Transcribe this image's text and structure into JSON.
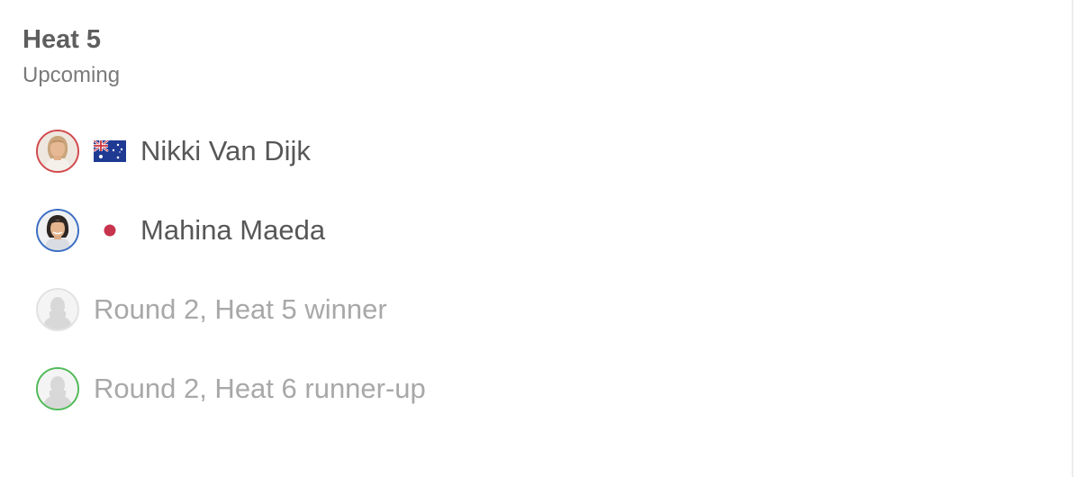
{
  "heat": {
    "title": "Heat 5",
    "status": "Upcoming"
  },
  "athletes": [
    {
      "name": "Nikki Van Dijk",
      "country_flag": "australia-flag-icon",
      "ring_color": "#d24a4f"
    },
    {
      "name": "Mahina Maeda",
      "country_flag": "japan-flag-icon",
      "ring_color": "#3d6fc4"
    }
  ],
  "placeholders": [
    {
      "label": "Round 2, Heat 5 winner",
      "ring_color": "#e2e2e2"
    },
    {
      "label": "Round 2, Heat 6 runner-up",
      "ring_color": "#52bb5a"
    }
  ]
}
